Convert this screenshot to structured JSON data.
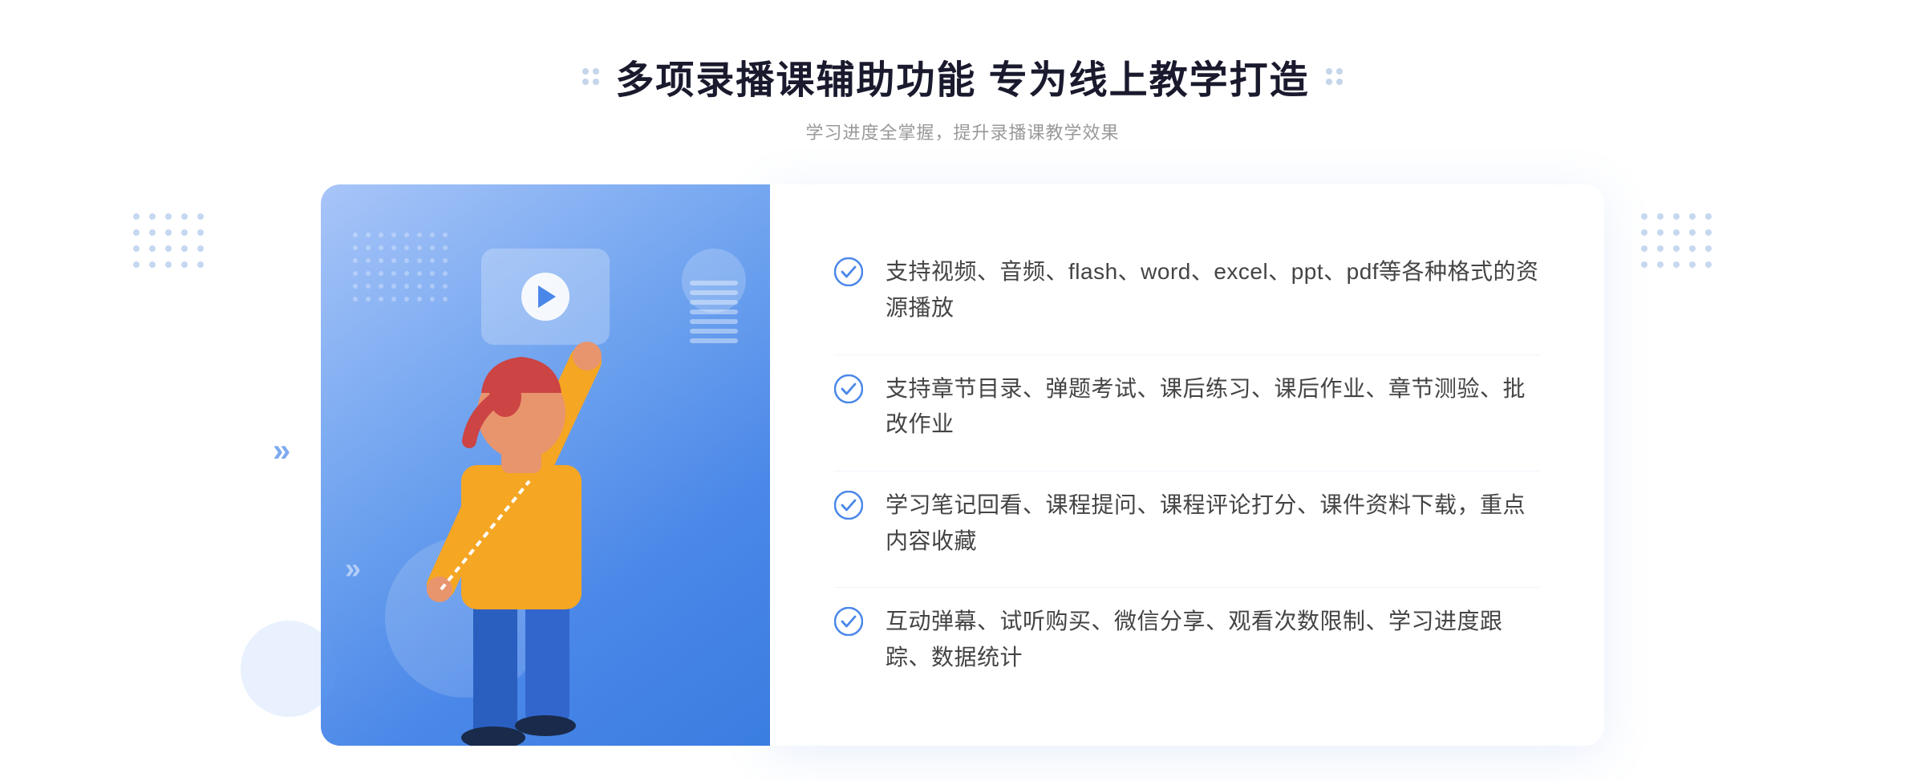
{
  "header": {
    "title": "多项录播课辅助功能 专为线上教学打造",
    "subtitle": "学习进度全掌握，提升录播课教学效果"
  },
  "features": [
    {
      "id": 1,
      "text": "支持视频、音频、flash、word、excel、ppt、pdf等各种格式的资源播放"
    },
    {
      "id": 2,
      "text": "支持章节目录、弹题考试、课后练习、课后作业、章节测验、批改作业"
    },
    {
      "id": 3,
      "text": "学习笔记回看、课程提问、课程评论打分、课件资料下载，重点内容收藏"
    },
    {
      "id": 4,
      "text": "互动弹幕、试听购买、微信分享、观看次数限制、学习进度跟踪、数据统计"
    }
  ],
  "colors": {
    "primary": "#4a87e8",
    "primaryLight": "#a8c5f8",
    "titleColor": "#1a1a2e",
    "subtitleColor": "#999999",
    "textColor": "#444444",
    "checkColor": "#4a87e8"
  },
  "icons": {
    "check": "check-circle-icon",
    "play": "play-icon",
    "dots": "decorative-dots"
  }
}
